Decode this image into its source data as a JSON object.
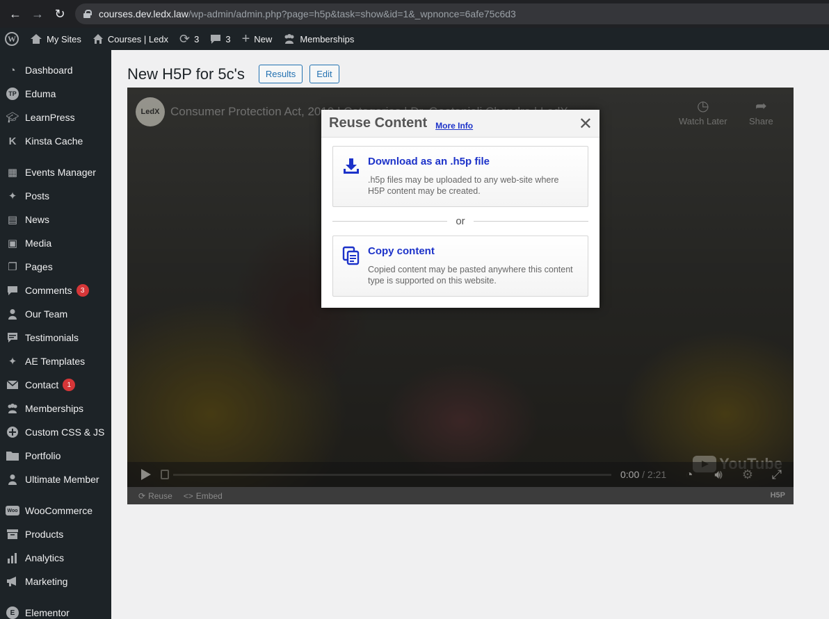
{
  "browser": {
    "url_host": "courses.dev.ledx.law",
    "url_path": "/wp-admin/admin.php?page=h5p&task=show&id=1&_wpnonce=6afe75c6d3"
  },
  "adminbar": {
    "my_sites": "My Sites",
    "site_name": "Courses | Ledx",
    "updates_count": "3",
    "comments_count": "3",
    "new_label": "New",
    "memberships": "Memberships"
  },
  "sidebar": {
    "items": [
      {
        "label": "Dashboard",
        "icon": "dashboard-icon"
      },
      {
        "label": "Eduma",
        "icon": "eduma-icon"
      },
      {
        "label": "LearnPress",
        "icon": "graduation-cap-icon"
      },
      {
        "label": "Kinsta Cache",
        "icon": "kinsta-icon"
      },
      {
        "label": "Events Manager",
        "icon": "calendar-icon"
      },
      {
        "label": "Posts",
        "icon": "pin-icon"
      },
      {
        "label": "News",
        "icon": "news-icon"
      },
      {
        "label": "Media",
        "icon": "media-icon"
      },
      {
        "label": "Pages",
        "icon": "pages-icon"
      },
      {
        "label": "Comments",
        "icon": "comment-icon",
        "badge": "3"
      },
      {
        "label": "Our Team",
        "icon": "person-icon"
      },
      {
        "label": "Testimonials",
        "icon": "testimonial-icon"
      },
      {
        "label": "AE Templates",
        "icon": "pin-icon"
      },
      {
        "label": "Contact",
        "icon": "mail-icon",
        "badge": "1"
      },
      {
        "label": "Memberships",
        "icon": "groups-icon"
      },
      {
        "label": "Custom CSS & JS",
        "icon": "plus-circle-icon"
      },
      {
        "label": "Portfolio",
        "icon": "folder-icon"
      },
      {
        "label": "Ultimate Member",
        "icon": "person-icon"
      },
      {
        "label": "WooCommerce",
        "icon": "woo-icon"
      },
      {
        "label": "Products",
        "icon": "archive-icon"
      },
      {
        "label": "Analytics",
        "icon": "bar-chart-icon"
      },
      {
        "label": "Marketing",
        "icon": "megaphone-icon"
      },
      {
        "label": "Elementor",
        "icon": "elementor-icon"
      }
    ]
  },
  "page": {
    "title": "New H5P for 5c's",
    "results_btn": "Results",
    "edit_btn": "Edit"
  },
  "video": {
    "channel_logo": "LedX",
    "title": "Consumer Protection Act, 2019 | Categories | Dr. Geetanjali Chandra | LedX",
    "watch_later": "Watch Later",
    "share": "Share",
    "brand": "YouTube",
    "time_current": "0:00",
    "time_sep": " / ",
    "time_duration": "2:21"
  },
  "h5p_bar": {
    "reuse": "Reuse",
    "embed": "Embed",
    "h5p_mark": "H5P"
  },
  "dialog": {
    "title": "Reuse Content",
    "more_info": "More Info",
    "close": "✕",
    "download_title": "Download as an .h5p file",
    "download_desc": ".h5p files may be uploaded to any web-site where H5P content may be created.",
    "or": "or",
    "copy_title": "Copy content",
    "copy_desc": "Copied content may be pasted anywhere this content type is supported on this website."
  },
  "colors": {
    "admin_bg": "#1d2327",
    "wp_blue": "#2271b1",
    "h5p_blue": "#1c32c9",
    "badge_red": "#d63638"
  }
}
